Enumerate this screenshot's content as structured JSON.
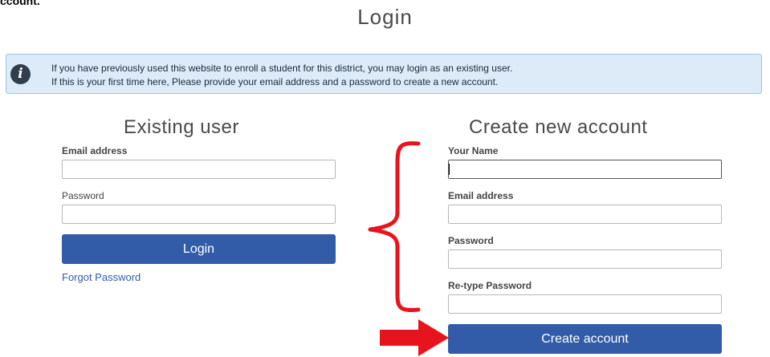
{
  "crop_text": "ccount.",
  "page_title": "Login",
  "info": {
    "icon": "info-icon",
    "line1": "If you have previously used this website to enroll a student for this district, you may login as an existing user.",
    "line2": "If this is your first time here, Please provide your email address and a password to create a new account."
  },
  "existing_user": {
    "title": "Existing user",
    "email_label": "Email address",
    "email_value": "",
    "password_label": "Password",
    "password_value": "",
    "login_button": "Login",
    "forgot_link": "Forgot Password"
  },
  "new_account": {
    "title": "Create new account",
    "name_label": "Your Name",
    "name_value": "",
    "email_label": "Email address",
    "email_value": "",
    "password_label": "Password",
    "password_value": "",
    "retype_label": "Re-type Password",
    "retype_value": "",
    "create_button": "Create account"
  },
  "annotations": {
    "color": "#e8141d",
    "brace": "brace-annotation",
    "arrow": "arrow-annotation"
  },
  "colors": {
    "primary_button": "#335ca8",
    "info_background": "#dcebf7",
    "info_border": "#9cc5e3",
    "link": "#335ca8"
  }
}
